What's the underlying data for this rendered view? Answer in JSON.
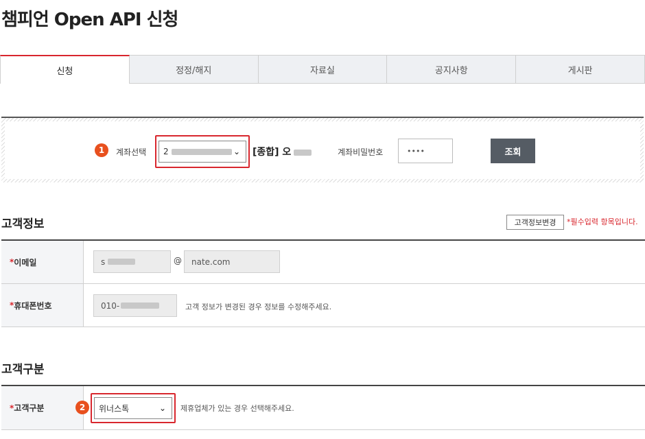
{
  "title": "챔피언 Open API 신청",
  "tabs": [
    "신청",
    "정정/해지",
    "자료실",
    "공지사항",
    "게시판"
  ],
  "account": {
    "step": "1",
    "label": "계좌선택",
    "select_value_prefix": "2",
    "account_type": "[종합] 오",
    "password_label": "계좌비밀번호",
    "password_value": "••••",
    "search_button": "조회"
  },
  "customer_info": {
    "title": "고객정보",
    "change_button": "고객정보변경",
    "required_note": "*필수입력 항목입니다.",
    "email_label": "이메일",
    "email_local_prefix": "s",
    "email_at": "@",
    "email_domain": "nate.com",
    "phone_label": "휴대폰번호",
    "phone_prefix": "010-",
    "phone_help": "고객 정보가 변경된 경우 정보를 수정해주세요."
  },
  "customer_type": {
    "title": "고객구분",
    "step": "2",
    "label": "고객구분",
    "select_value": "위너스톡",
    "help": "제휴업체가 있는 경우 선택해주세요."
  },
  "colors": {
    "accent_red": "#d8262d",
    "badge_orange": "#e8501e",
    "button_dark": "#555c64"
  }
}
